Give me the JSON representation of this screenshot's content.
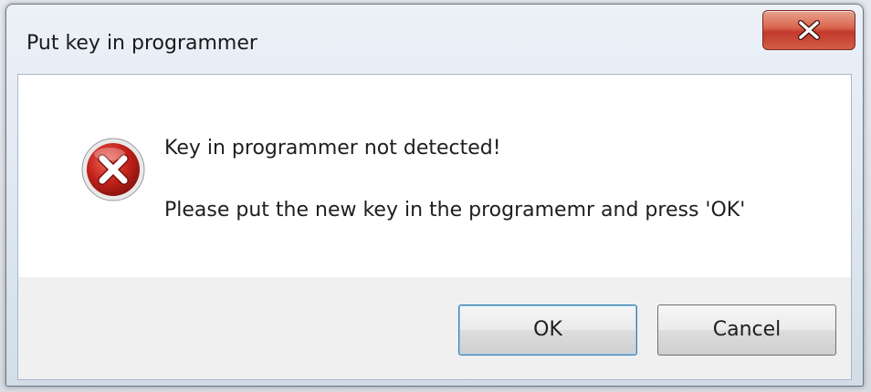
{
  "window": {
    "title": "Put key in programmer"
  },
  "titlebar": {
    "close_icon": "close-icon"
  },
  "message": {
    "icon": "error-icon",
    "line1": "Key in programmer not detected!",
    "line2": "Please put the new key in the programemr and press 'OK'"
  },
  "buttons": {
    "ok_label": "OK",
    "cancel_label": "Cancel"
  },
  "colors": {
    "error_red": "#c4221b",
    "close_button_red": "#c0392b"
  }
}
